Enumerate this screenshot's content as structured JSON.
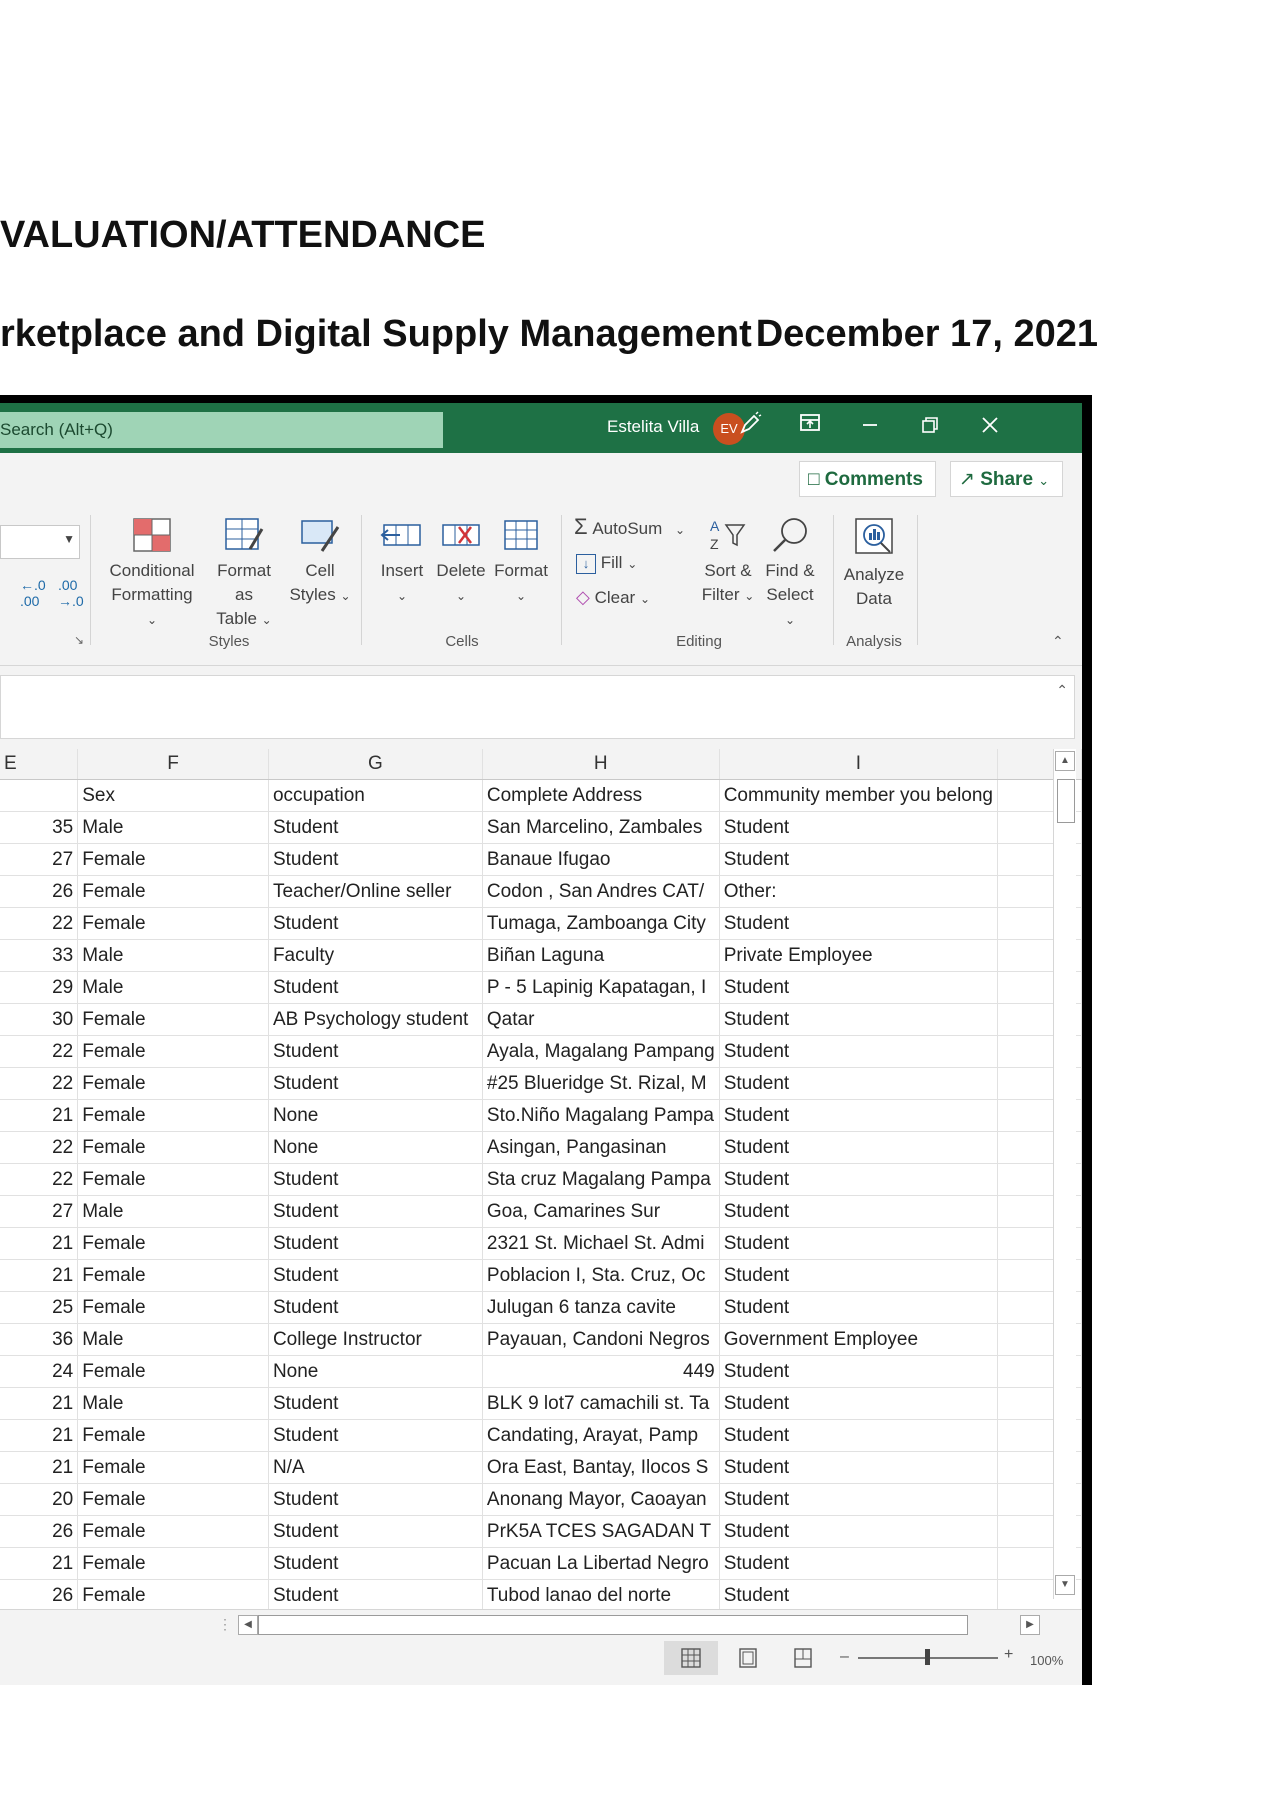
{
  "document": {
    "heading1": "VALUATION/ATTENDANCE",
    "heading2_course": "rketplace and Digital Supply Management",
    "heading2_date": "December 17, 2021"
  },
  "excel": {
    "search_placeholder": "Search (Alt+Q)",
    "user_name": "Estelita Villa",
    "user_initials": "EV",
    "comments_label": "Comments",
    "share_label": "Share",
    "ribbon": {
      "conditional_formatting": [
        "Conditional",
        "Formatting"
      ],
      "format_as_table": [
        "Format as",
        "Table"
      ],
      "cell_styles": [
        "Cell",
        "Styles"
      ],
      "insert": "Insert",
      "delete": "Delete",
      "format": "Format",
      "autosum": "AutoSum",
      "fill": "Fill",
      "clear": "Clear",
      "sort_filter": [
        "Sort &",
        "Filter"
      ],
      "find_select": [
        "Find &",
        "Select"
      ],
      "analyze_data": [
        "Analyze",
        "Data"
      ],
      "groups": {
        "styles": "Styles",
        "cells": "Cells",
        "editing": "Editing",
        "analysis": "Analysis"
      }
    },
    "columns": [
      "E",
      "F",
      "G",
      "H",
      "I"
    ],
    "headers": [
      "",
      "Sex",
      "occupation",
      "Complete Address",
      "Community member you belong"
    ],
    "rows": [
      [
        "35",
        "Male",
        "Student",
        "San Marcelino, Zambales",
        "Student"
      ],
      [
        "27",
        "Female",
        "Student",
        "Banaue Ifugao",
        "Student"
      ],
      [
        "26",
        "Female",
        "Teacher/Online seller",
        "Codon , San Andres CAT/",
        "Other:"
      ],
      [
        "22",
        "Female",
        "Student",
        "Tumaga, Zamboanga City",
        "Student"
      ],
      [
        "33",
        "Male",
        "Faculty",
        "Biñan Laguna",
        "Private  Employee"
      ],
      [
        "29",
        "Male",
        "Student",
        "P - 5 Lapinig Kapatagan, I",
        "Student"
      ],
      [
        "30",
        "Female",
        "AB Psychology student",
        "Qatar",
        "Student"
      ],
      [
        "22",
        "Female",
        "Student",
        "Ayala, Magalang Pampang",
        "Student"
      ],
      [
        "22",
        "Female",
        "Student",
        "#25 Blueridge St. Rizal, M",
        "Student"
      ],
      [
        "21",
        "Female",
        "None",
        "Sto.Niño Magalang Pampa",
        "Student"
      ],
      [
        "22",
        "Female",
        "None",
        "Asingan, Pangasinan",
        "Student"
      ],
      [
        "22",
        "Female",
        "Student",
        "Sta cruz Magalang Pampa",
        "Student"
      ],
      [
        "27",
        "Male",
        "Student",
        "Goa, Camarines Sur",
        "Student"
      ],
      [
        "21",
        "Female",
        "Student",
        "2321 St. Michael St. Admi",
        "Student"
      ],
      [
        "21",
        "Female",
        "Student",
        "Poblacion I, Sta. Cruz, Oc",
        "Student"
      ],
      [
        "25",
        "Female",
        "Student",
        "Julugan 6 tanza cavite",
        "Student"
      ],
      [
        "36",
        "Male",
        "College Instructor",
        "Payauan, Candoni Negros",
        "Government Employee"
      ],
      [
        "24",
        "Female",
        "None",
        "449",
        "Student"
      ],
      [
        "21",
        "Male",
        "Student",
        "BLK 9 lot7 camachili st. Ta",
        "Student"
      ],
      [
        "21",
        "Female",
        "Student",
        "Candating, Arayat,  Pamp",
        "Student"
      ],
      [
        "21",
        "Female",
        "N/A",
        "Ora East, Bantay, Ilocos S",
        "Student"
      ],
      [
        "20",
        "Female",
        "Student",
        "Anonang Mayor, Caoayan",
        "Student"
      ],
      [
        "26",
        "Female",
        "Student",
        "PrK5A TCES SAGADAN T",
        "Student"
      ],
      [
        "21",
        "Female",
        "Student",
        "Pacuan La Libertad Negro",
        "Student"
      ],
      [
        "26",
        "Female",
        "Student",
        "Tubod lanao del norte",
        "Student"
      ]
    ],
    "zoom": "100%"
  }
}
